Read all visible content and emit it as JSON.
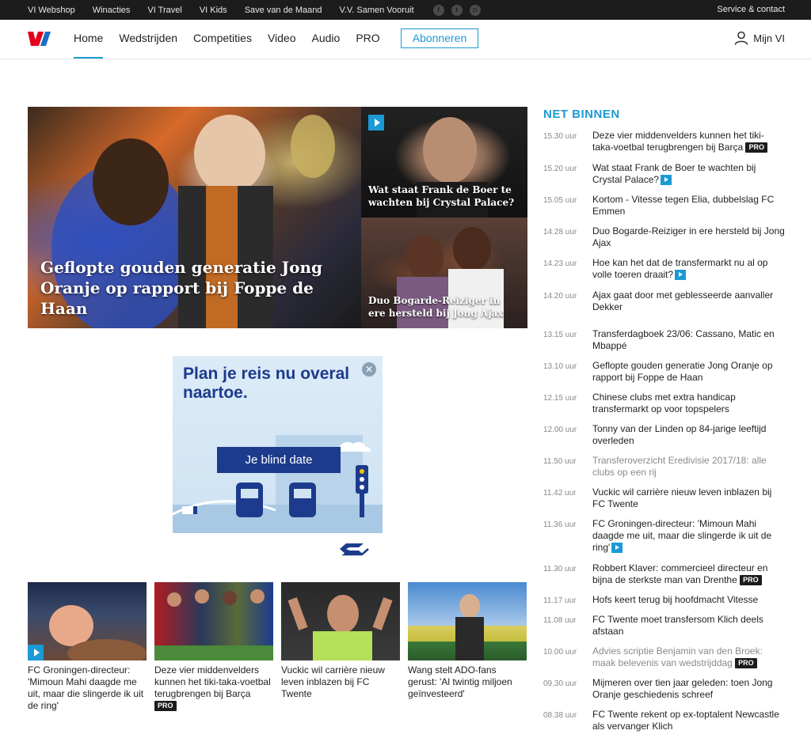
{
  "topbar": {
    "links": [
      "VI Webshop",
      "Winacties",
      "VI Travel",
      "VI Kids",
      "Save van de Maand",
      "V.V. Samen Vooruit"
    ],
    "service": "Service & contact"
  },
  "nav": {
    "items": [
      "Home",
      "Wedstrijden",
      "Competities",
      "Video",
      "Audio",
      "PRO"
    ],
    "subscribe": "Abonneren",
    "account": "Mijn VI"
  },
  "hero": {
    "main": "Geflopte gouden generatie Jong Oranje op rapport bij Foppe de Haan",
    "side1": "Wat staat Frank de Boer te wachten bij Crystal Palace?",
    "side2": "Duo Bogarde-Reiziger in ere hersteld bij Jong Ajax"
  },
  "ad": {
    "title": "Plan je reis nu overal naartoe.",
    "button": "Je blind date"
  },
  "cards": [
    {
      "text": "FC Groningen-directeur: 'Mimoun Mahi daagde me uit, maar die slingerde ik uit de ring'",
      "pro": ""
    },
    {
      "text": "Deze vier middenvelders kunnen het tiki-taka-voetbal terugbrengen bij Barça",
      "pro": "PRO"
    },
    {
      "text": "Vuckic wil carrière nieuw leven inblazen bij FC Twente",
      "pro": ""
    },
    {
      "text": "Wang stelt ADO-fans gerust: 'Al twintig miljoen geïnvesteerd'",
      "pro": ""
    }
  ],
  "net_binnen": {
    "title": "NET BINNEN",
    "items": [
      {
        "time": "15.30 uur",
        "text": "Deze vier middenvelders kunnen het tiki-taka-voetbal terugbrengen bij Barça",
        "badge": "PRO"
      },
      {
        "time": "15.20 uur",
        "text": "Wat staat Frank de Boer te wachten bij Crystal Palace?",
        "badge": "play"
      },
      {
        "time": "15.05 uur",
        "text": "Kortom - Vitesse tegen Elia, dubbelslag FC Emmen",
        "badge": ""
      },
      {
        "time": "14.28 uur",
        "text": "Duo Bogarde-Reiziger in ere hersteld bij Jong Ajax",
        "badge": ""
      },
      {
        "time": "14.23 uur",
        "text": "Hoe kan het dat de transfermarkt nu al op volle toeren draait?",
        "badge": "play"
      },
      {
        "time": "14.20 uur",
        "text": "Ajax gaat door met geblesseerde aanvaller Dekker",
        "badge": ""
      },
      {
        "time": "13.15 uur",
        "text": "Transferdagboek 23/06: Cassano, Matic en Mbappé",
        "badge": ""
      },
      {
        "time": "13.10 uur",
        "text": "Geflopte gouden generatie Jong Oranje op rapport bij Foppe de Haan",
        "badge": ""
      },
      {
        "time": "12.15 uur",
        "text": "Chinese clubs met extra handicap transfermarkt op voor topspelers",
        "badge": ""
      },
      {
        "time": "12.00 uur",
        "text": "Tonny van der Linden op 84-jarige leeftijd overleden",
        "badge": ""
      },
      {
        "time": "11.50 uur",
        "text": "Transferoverzicht Eredivisie 2017/18: alle clubs op een rij",
        "badge": ""
      },
      {
        "time": "11.42 uur",
        "text": "Vuckic wil carrière nieuw leven inblazen bij FC Twente",
        "badge": ""
      },
      {
        "time": "11.36 uur",
        "text": "FC Groningen-directeur: 'Mimoun Mahi daagde me uit, maar die slingerde ik uit de ring'",
        "badge": "play"
      },
      {
        "time": "11.30 uur",
        "text": "Robbert Klaver: commercieel directeur en bijna de sterkste man van Drenthe",
        "badge": "PRO"
      },
      {
        "time": "11.17 uur",
        "text": "Hofs keert terug bij hoofdmacht Vitesse",
        "badge": ""
      },
      {
        "time": "11.08 uur",
        "text": "FC Twente moet transfersom Klich deels afstaan",
        "badge": ""
      },
      {
        "time": "10.00 uur",
        "text": "Advies scriptie Benjamin van den Broek: maak belevenis van wedstrijddag",
        "badge": "PRO"
      },
      {
        "time": "09.30 uur",
        "text": "Mijmeren over tien jaar geleden: toen Jong Oranje geschiedenis schreef",
        "badge": ""
      },
      {
        "time": "08.38 uur",
        "text": "FC Twente rekent op ex-toptalent Newcastle als vervanger Klich",
        "badge": ""
      }
    ]
  },
  "colors": {
    "accent": "#1a9ad6",
    "brand_red": "#e3001b",
    "topbar": "#1c1c1c"
  }
}
